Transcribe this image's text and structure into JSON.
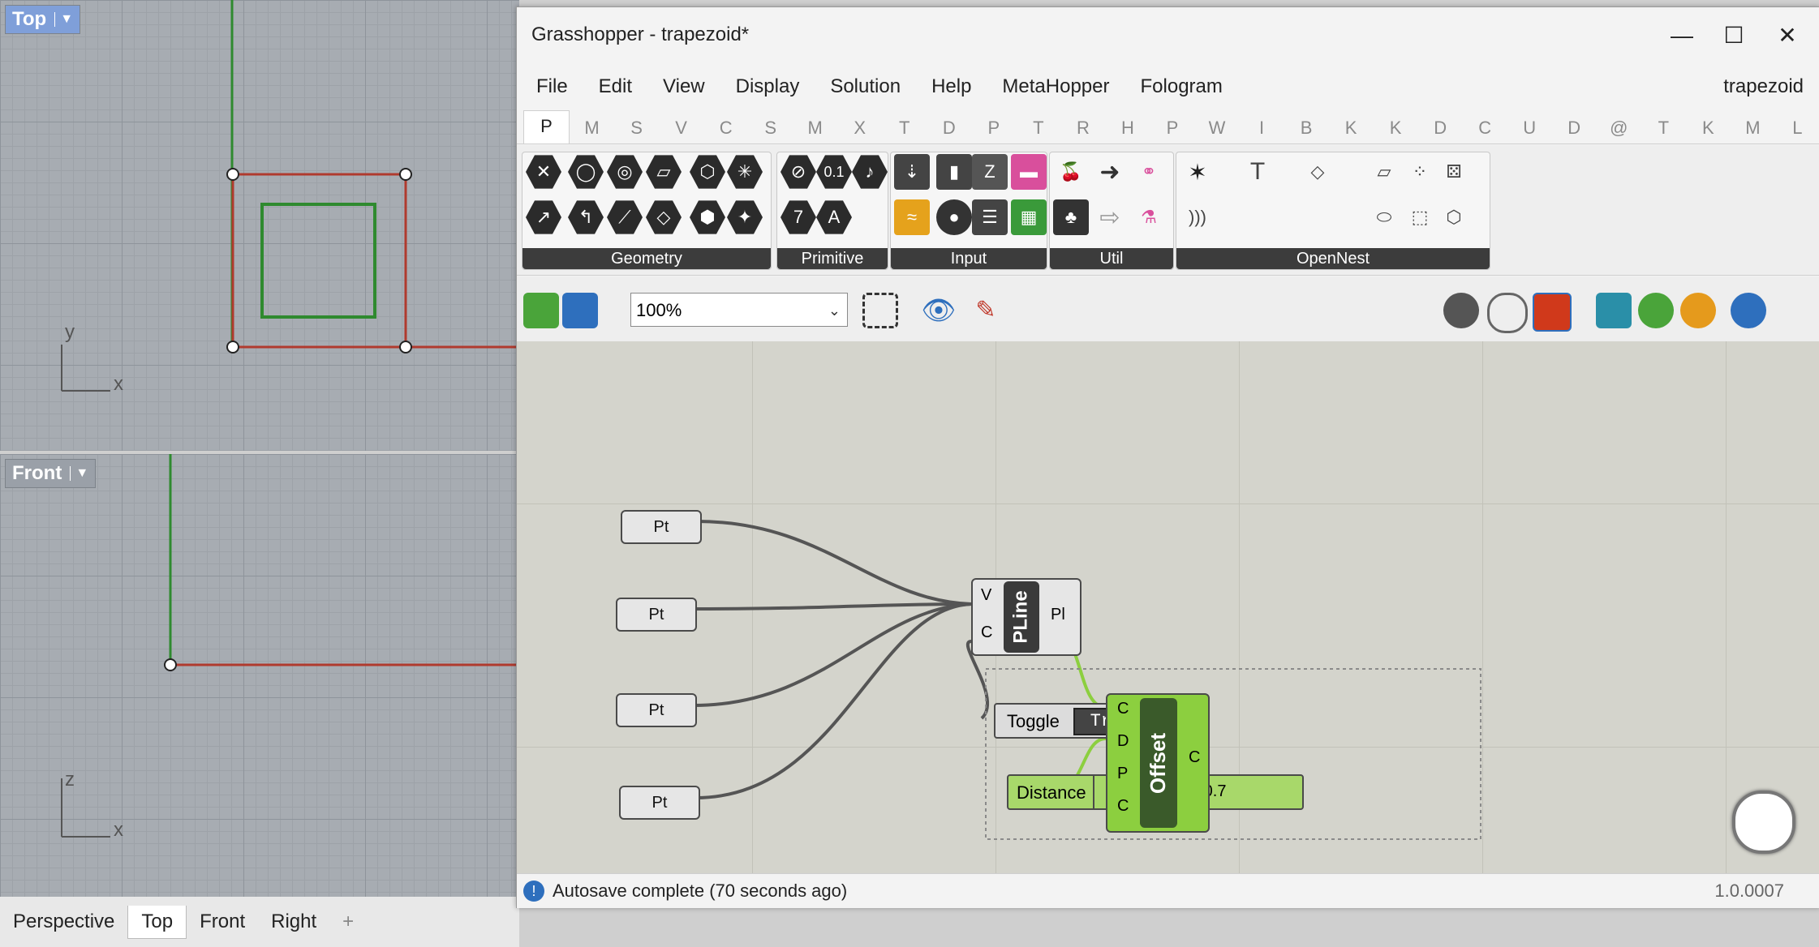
{
  "rhino": {
    "viewport_top": {
      "label": "Top",
      "axis_y": "y",
      "axis_x": "x"
    },
    "viewport_front": {
      "label": "Front",
      "axis_z": "z",
      "axis_x": "x"
    },
    "view_tabs": [
      "Perspective",
      "Top",
      "Front",
      "Right"
    ],
    "add_tab_icon": "+"
  },
  "grasshopper": {
    "window_title": "Grasshopper - trapezoid*",
    "window_buttons": {
      "minimize": "—",
      "maximize": "☐",
      "close": "✕"
    },
    "menu": [
      "File",
      "Edit",
      "View",
      "Display",
      "Solution",
      "Help",
      "MetaHopper",
      "Fologram"
    ],
    "document_name": "trapezoid",
    "category_tabs": [
      "P",
      "M",
      "S",
      "V",
      "C",
      "S",
      "M",
      "X",
      "T",
      "D",
      "P",
      "T",
      "R",
      "H",
      "P",
      "W",
      "I",
      "B",
      "K",
      "K",
      "D",
      "C",
      "U",
      "D",
      "@",
      "T",
      "K",
      "M",
      "L"
    ],
    "ribbon_groups": [
      "Geometry",
      "Primitive",
      "Input",
      "Util",
      "OpenNest"
    ],
    "zoom": {
      "value": "100%"
    },
    "status": "Autosave complete (70 seconds ago)",
    "version": "1.0.0007",
    "components": {
      "pt": "Pt",
      "pline": {
        "name": "PLine",
        "inputs": [
          "V",
          "C"
        ],
        "output": "Pl"
      },
      "toggle": {
        "label": "Toggle",
        "value": "True"
      },
      "distance": {
        "label": "Distance",
        "value": "-0.7"
      },
      "offset": {
        "name": "Offset",
        "inputs": [
          "C",
          "D",
          "P",
          "C"
        ],
        "output": "C"
      }
    }
  },
  "colors": {
    "accent_green": "#8ccf3f",
    "viewport_bg": "#a7acb2",
    "canvas_bg": "#d4d4cc"
  }
}
